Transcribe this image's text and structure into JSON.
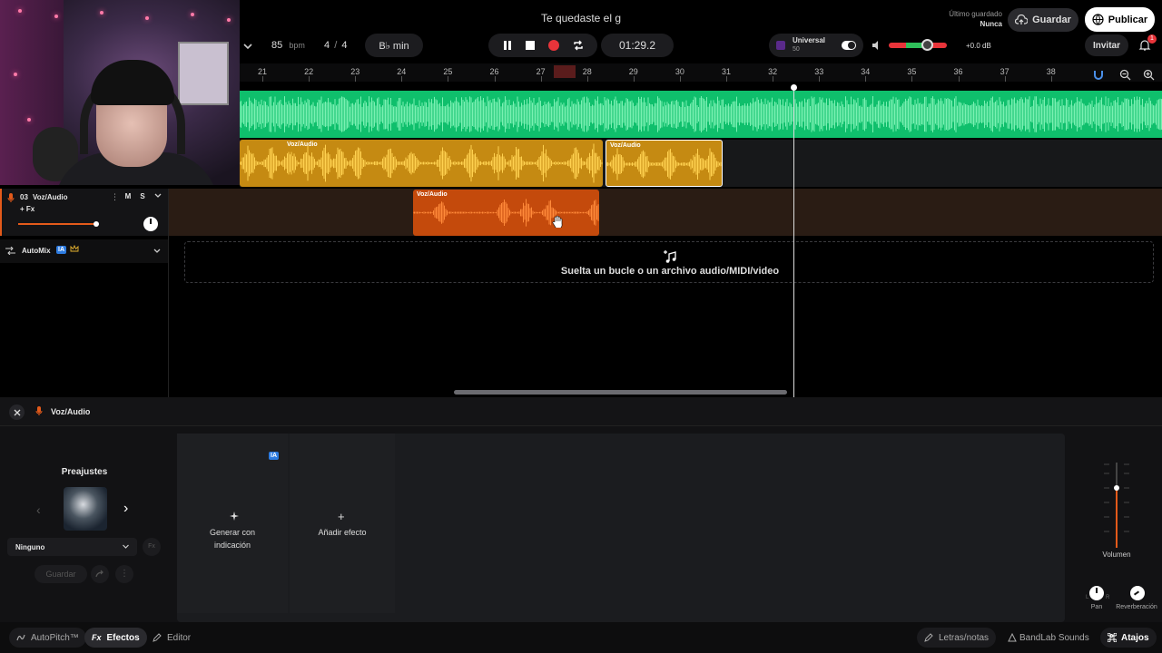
{
  "header": {
    "project_title": "Te quedaste el g",
    "last_saved_label": "Último guardado",
    "last_saved_value": "Nunca",
    "save_label": "Guardar",
    "publish_label": "Publicar",
    "invite_label": "Invitar",
    "notification_count": "1"
  },
  "transport": {
    "tempo": "85",
    "tempo_unit": "bpm",
    "time_sig_num": "4",
    "time_sig_sep": "/",
    "time_sig_den": "4",
    "key": "B♭ min",
    "time": "01:29.2"
  },
  "master": {
    "preset_name": "Universal",
    "preset_value": "50",
    "volume_db": "+0.0 dB"
  },
  "ruler": {
    "bars": [
      "21",
      "22",
      "23",
      "24",
      "25",
      "26",
      "27",
      "28",
      "29",
      "30",
      "31",
      "32",
      "33",
      "34",
      "35",
      "36",
      "37",
      "38"
    ]
  },
  "tracks": {
    "voz": {
      "number": "03",
      "name": "Voz/Audio",
      "fx_label": "+ Fx",
      "mute_label": "M",
      "solo_label": "S"
    },
    "automix": {
      "name": "AutoMix",
      "ai_badge": "IA"
    },
    "clip_label": "Voz/Audio"
  },
  "dropzone": {
    "text": "Suelta un bucle o un archivo audio/MIDI/video"
  },
  "panel": {
    "track_name": "Voz/Audio",
    "presets_title": "Preajustes",
    "preset_select": "Ninguno",
    "save_label": "Guardar",
    "ai_badge": "IA",
    "generate_label_1": "Generar con",
    "generate_label_2": "indicación",
    "add_effect_label": "Añadir efecto",
    "volume_label": "Volumen",
    "pan_label": "Pan",
    "reverb_label": "Reverberación",
    "pan_l": "L",
    "pan_r": "R"
  },
  "bottom_bar": {
    "autopitch": "AutoPitch™",
    "effects": "Efectos",
    "editor": "Editor",
    "lyrics": "Letras/notas",
    "sounds": "BandLab Sounds",
    "shortcuts": "Atajos"
  },
  "colors": {
    "green": "#0fbf6c",
    "yellow": "#f0b21e",
    "orange": "#e85d12",
    "record": "#e8343a",
    "accent_blue": "#2d7be0"
  }
}
